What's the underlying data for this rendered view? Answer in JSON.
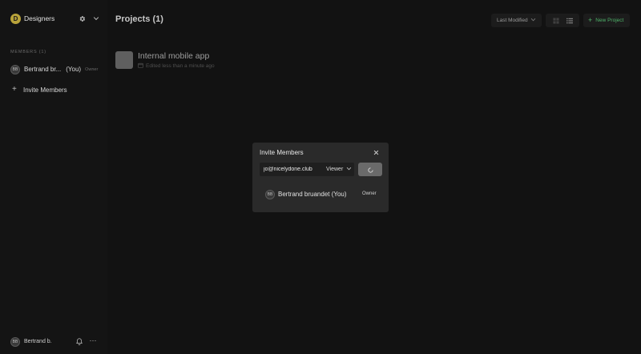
{
  "sidebar": {
    "team": {
      "initial": "D",
      "name": "Designers",
      "avatar_color": "#b9a33a"
    },
    "members_heading": "MEMBERS (1)",
    "members": [
      {
        "initials": "BB",
        "name": "Bertrand br...",
        "you": "(You)",
        "role": "Owner"
      }
    ],
    "invite_label": "Invite Members",
    "current_user": {
      "initials": "BB",
      "name": "Bertrand b."
    },
    "icons": [
      "settings-gear-icon",
      "chevron-down-icon",
      "plus-icon",
      "bell-icon",
      "more-dots-icon"
    ]
  },
  "main": {
    "title": "Projects (1)",
    "sort": {
      "label": "Last Modified"
    },
    "new_project_label": "New Project",
    "accent_color": "#4fb36a",
    "projects": [
      {
        "name": "Internal mobile app",
        "meta": "Edited less than a minute ago"
      }
    ]
  },
  "modal": {
    "title": "Invite Members",
    "email_value": "jo@nicelydone.club",
    "role_value": "Viewer",
    "member": {
      "initials": "BB",
      "name": "Bertrand bruandet (You)",
      "role": "Owner"
    }
  }
}
